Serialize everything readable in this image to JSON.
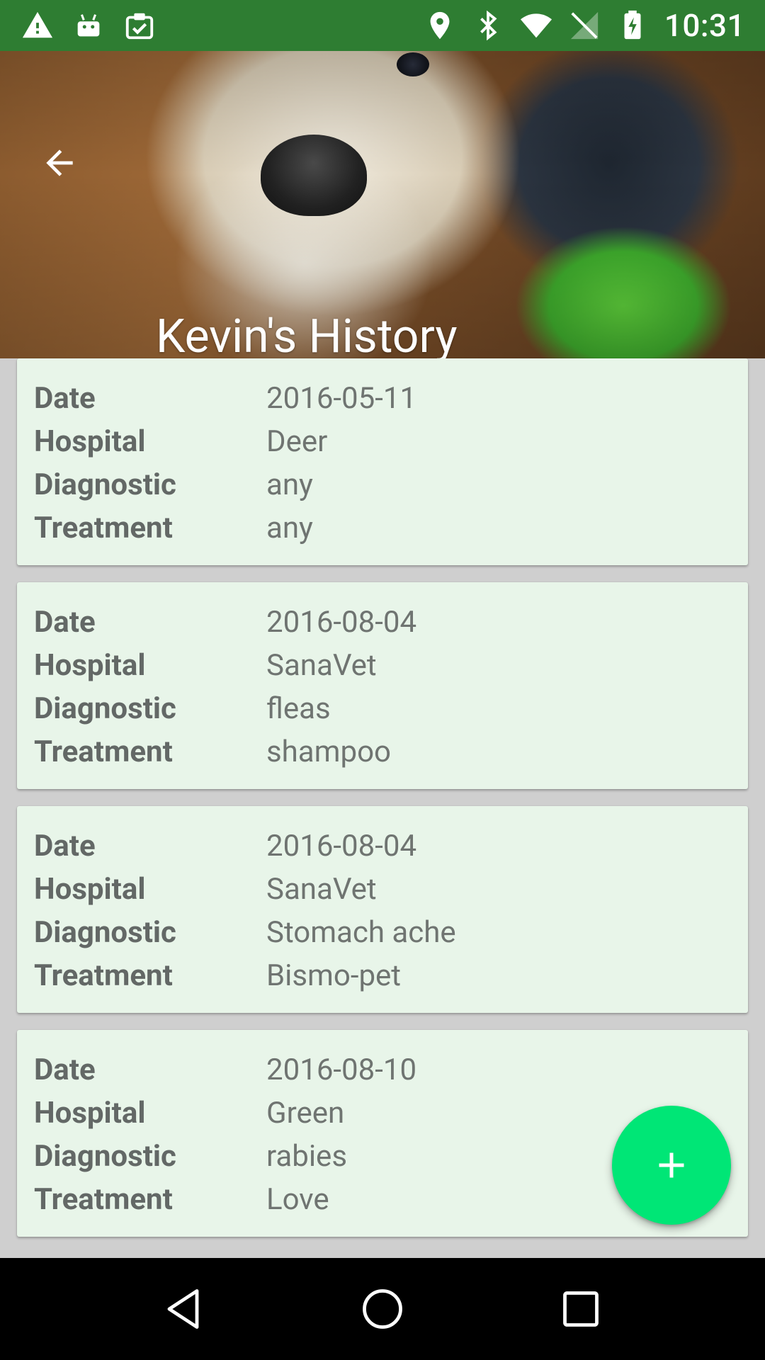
{
  "status_bar": {
    "time": "10:31",
    "left_icons": [
      "warning-icon",
      "android-icon",
      "clipboard-check-icon"
    ],
    "right_icons": [
      "location-icon",
      "bluetooth-icon",
      "wifi-icon",
      "no-signal-icon",
      "battery-charging-icon"
    ],
    "background": "#2e7d32"
  },
  "header": {
    "title": "Kevin's History",
    "back_icon": "arrow-back-icon"
  },
  "records": [
    {
      "date_label": "Date",
      "date": "2016-05-11",
      "hospital_label": "Hospital",
      "hospital": "Deer",
      "diagnostic_label": "Diagnostic",
      "diagnostic": "any",
      "treatment_label": "Treatment",
      "treatment": "any"
    },
    {
      "date_label": "Date",
      "date": "2016-08-04",
      "hospital_label": "Hospital",
      "hospital": "SanaVet",
      "diagnostic_label": "Diagnostic",
      "diagnostic": "fleas",
      "treatment_label": "Treatment",
      "treatment": "shampoo"
    },
    {
      "date_label": "Date",
      "date": "2016-08-04",
      "hospital_label": "Hospital",
      "hospital": "SanaVet",
      "diagnostic_label": "Diagnostic",
      "diagnostic": "Stomach ache",
      "treatment_label": "Treatment",
      "treatment": "Bismo-pet"
    },
    {
      "date_label": "Date",
      "date": "2016-08-10",
      "hospital_label": "Hospital",
      "hospital": "Green",
      "diagnostic_label": "Diagnostic",
      "diagnostic": "rabies",
      "treatment_label": "Treatment",
      "treatment": "Love"
    }
  ],
  "fab": {
    "icon": "plus-icon",
    "color": "#00e676"
  },
  "nav_bar": {
    "icons": [
      "back-triangle-icon",
      "home-circle-icon",
      "recents-square-icon"
    ]
  },
  "colors": {
    "card_background": "#e8f5e9",
    "label_text": "#636866",
    "value_text": "#6f7471"
  }
}
